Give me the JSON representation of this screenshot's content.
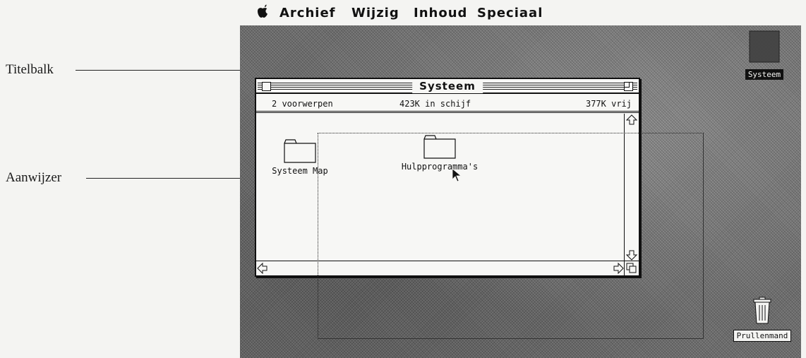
{
  "callouts": {
    "title_bar": "Titelbalk",
    "pointer": "Aanwijzer"
  },
  "menubar": {
    "apple_icon": "apple-icon",
    "items": [
      "Archief",
      "Wijzig",
      "Inhoud",
      "Speciaal"
    ]
  },
  "window": {
    "title": "Systeem",
    "info": {
      "item_count": "2 voorwerpen",
      "disk_used": "423K in schijf",
      "disk_free": "377K vrij"
    },
    "folders": [
      "Systeem Map",
      "Hulpprogramma's"
    ]
  },
  "desktop": {
    "disk_icon_label": "Systeem",
    "trash_label": "Prullenmand"
  },
  "colors": {
    "desktop": "#6d6d6d",
    "window": "#f7f7f5",
    "ink": "#111111"
  }
}
